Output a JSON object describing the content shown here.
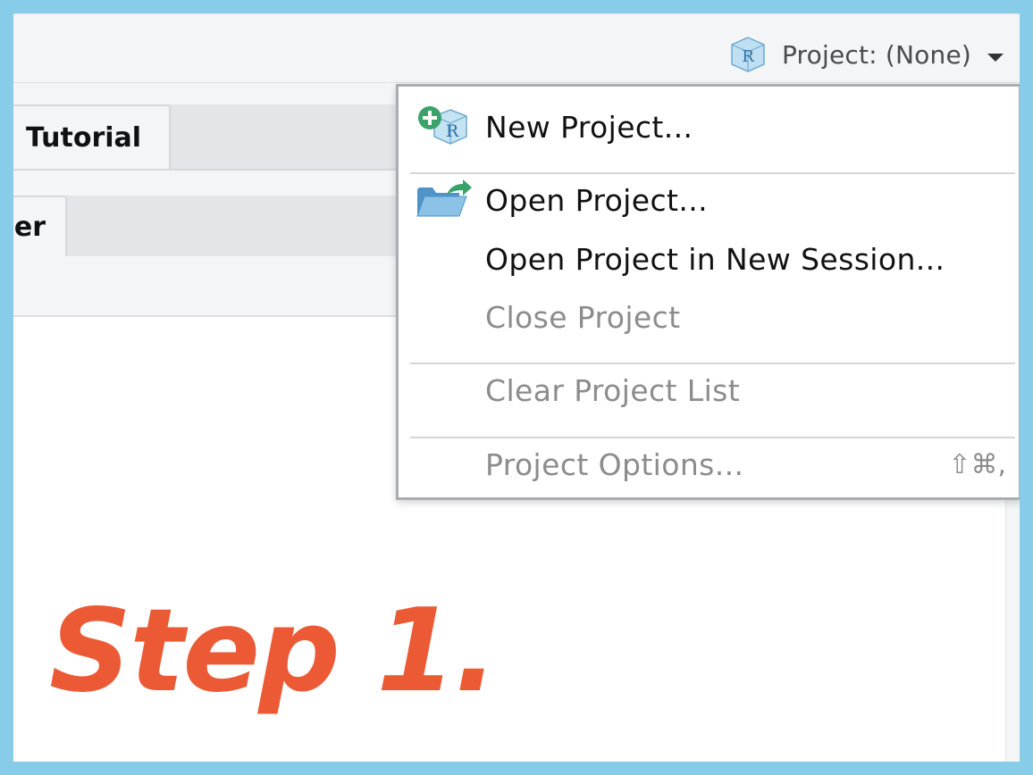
{
  "toolbar": {
    "project_label": "Project: (None)",
    "project_icon": "r-project-cube-icon"
  },
  "tabs": {
    "row1_label": "Tutorial",
    "row2_label": "er"
  },
  "project_menu": {
    "items": [
      {
        "label": "New Project...",
        "icon": "new-project-icon",
        "enabled": true
      },
      {
        "label": "Open Project...",
        "icon": "open-folder-icon",
        "enabled": true
      },
      {
        "label": "Open Project in New Session...",
        "enabled": true
      },
      {
        "label": "Close Project",
        "enabled": false
      },
      {
        "label": "Clear Project List",
        "enabled": false
      },
      {
        "label": "Project Options...",
        "enabled": false,
        "shortcut": "⇧⌘,"
      }
    ]
  },
  "annotation": {
    "step_text": "Step 1."
  },
  "colors": {
    "frame_border": "#87cdea",
    "annotation": "#ec5a35",
    "disabled_text": "#8c8c8c"
  }
}
